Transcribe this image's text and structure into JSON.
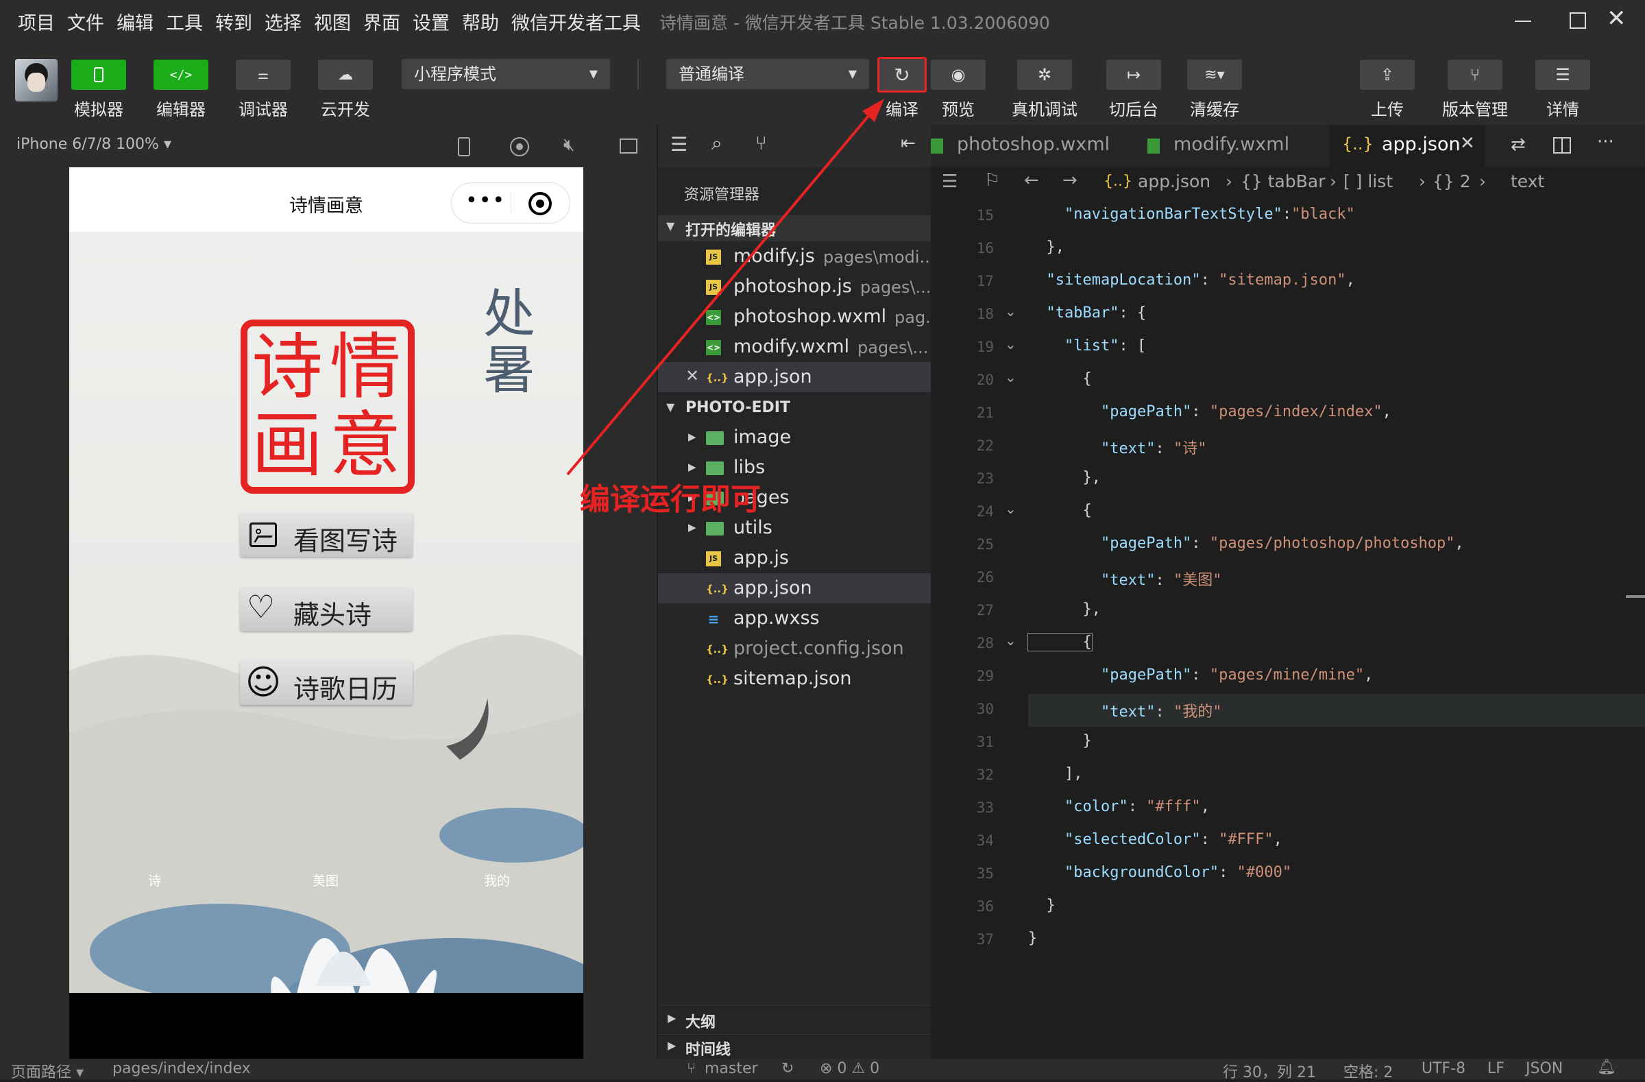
{
  "menu": [
    "项目",
    "文件",
    "编辑",
    "工具",
    "转到",
    "选择",
    "视图",
    "界面",
    "设置",
    "帮助",
    "微信开发者工具"
  ],
  "window_title": "诗情画意 - 微信开发者工具 Stable 1.03.2006090",
  "toolbar": {
    "simulator": "模拟器",
    "editor": "编辑器",
    "debugger": "调试器",
    "cloud": "云开发",
    "mode_select": "小程序模式",
    "compile_select": "普通编译",
    "compile": "编译",
    "preview": "预览",
    "real_debug": "真机调试",
    "background": "切后台",
    "clear_cache": "清缓存",
    "upload": "上传",
    "version": "版本管理",
    "details": "详情"
  },
  "simulator": {
    "device": "iPhone 6/7/8 100% ▾",
    "nav_title": "诗情画意",
    "seal_chars": [
      "诗",
      "情",
      "画",
      "意"
    ],
    "calligraphy": [
      "处",
      "暑"
    ],
    "buttons": [
      "看图写诗",
      "藏头诗",
      "诗歌日历"
    ],
    "tabs": [
      "诗",
      "美图",
      "我的"
    ]
  },
  "annotation": "编译运行即可",
  "explorer": {
    "title": "资源管理器",
    "open_editors_header": "打开的编辑器",
    "open_editors": [
      {
        "name": "modify.js",
        "path": "pages\\modi...",
        "icon": "js"
      },
      {
        "name": "photoshop.js",
        "path": "pages\\...",
        "icon": "js"
      },
      {
        "name": "photoshop.wxml",
        "path": "pag...",
        "icon": "wxml"
      },
      {
        "name": "modify.wxml",
        "path": "pages\\...",
        "icon": "wxml"
      },
      {
        "name": "app.json",
        "path": "",
        "icon": "json"
      }
    ],
    "project_header": "PHOTO-EDIT",
    "folders": [
      "image",
      "libs",
      "pages",
      "utils"
    ],
    "files": [
      {
        "name": "app.js",
        "icon": "js"
      },
      {
        "name": "app.json",
        "icon": "json"
      },
      {
        "name": "app.wxss",
        "icon": "wxss"
      },
      {
        "name": "project.config.json",
        "icon": "json"
      },
      {
        "name": "sitemap.json",
        "icon": "json"
      }
    ],
    "outline": "大纲",
    "timeline": "时间线"
  },
  "tabs": [
    "photoshop.wxml",
    "modify.wxml",
    "app.json"
  ],
  "breadcrumb": {
    "file": "app.json",
    "parts": [
      "{} tabBar",
      "[ ] list",
      "{} 2",
      "text"
    ]
  },
  "code_lines": [
    {
      "n": "15",
      "t": [
        [
          "    ",
          "p"
        ],
        [
          "\"navigationBarTextStyle\"",
          "k"
        ],
        [
          ":",
          "p"
        ],
        [
          "\"black\"",
          "s"
        ]
      ]
    },
    {
      "n": "16",
      "t": [
        [
          "  },",
          "p"
        ]
      ]
    },
    {
      "n": "17",
      "t": [
        [
          "  ",
          "p"
        ],
        [
          "\"sitemapLocation\"",
          "k"
        ],
        [
          ": ",
          "p"
        ],
        [
          "\"sitemap.json\"",
          "s"
        ],
        [
          ",",
          "p"
        ]
      ]
    },
    {
      "n": "18",
      "t": [
        [
          "  ",
          "p"
        ],
        [
          "\"tabBar\"",
          "k"
        ],
        [
          ": {",
          "p"
        ]
      ]
    },
    {
      "n": "19",
      "t": [
        [
          "    ",
          "p"
        ],
        [
          "\"list\"",
          "k"
        ],
        [
          ": [",
          "p"
        ]
      ]
    },
    {
      "n": "20",
      "t": [
        [
          "      {",
          "p"
        ]
      ]
    },
    {
      "n": "21",
      "t": [
        [
          "        ",
          "p"
        ],
        [
          "\"pagePath\"",
          "k"
        ],
        [
          ": ",
          "p"
        ],
        [
          "\"pages/index/index\"",
          "s"
        ],
        [
          ",",
          "p"
        ]
      ]
    },
    {
      "n": "22",
      "t": [
        [
          "        ",
          "p"
        ],
        [
          "\"text\"",
          "k"
        ],
        [
          ": ",
          "p"
        ],
        [
          "\"诗\"",
          "s"
        ]
      ]
    },
    {
      "n": "23",
      "t": [
        [
          "      },",
          "p"
        ]
      ]
    },
    {
      "n": "24",
      "t": [
        [
          "      {",
          "p"
        ]
      ]
    },
    {
      "n": "25",
      "t": [
        [
          "        ",
          "p"
        ],
        [
          "\"pagePath\"",
          "k"
        ],
        [
          ": ",
          "p"
        ],
        [
          "\"pages/photoshop/photoshop\"",
          "s"
        ],
        [
          ",",
          "p"
        ]
      ]
    },
    {
      "n": "26",
      "t": [
        [
          "        ",
          "p"
        ],
        [
          "\"text\"",
          "k"
        ],
        [
          ": ",
          "p"
        ],
        [
          "\"美图\"",
          "s"
        ]
      ]
    },
    {
      "n": "27",
      "t": [
        [
          "      },",
          "p"
        ]
      ]
    },
    {
      "n": "28",
      "t": [
        [
          "      {",
          "p"
        ]
      ]
    },
    {
      "n": "29",
      "t": [
        [
          "        ",
          "p"
        ],
        [
          "\"pagePath\"",
          "k"
        ],
        [
          ": ",
          "p"
        ],
        [
          "\"pages/mine/mine\"",
          "s"
        ],
        [
          ",",
          "p"
        ]
      ]
    },
    {
      "n": "30",
      "t": [
        [
          "        ",
          "p"
        ],
        [
          "\"text\"",
          "k"
        ],
        [
          ": ",
          "p"
        ],
        [
          "\"我的\"",
          "s"
        ]
      ]
    },
    {
      "n": "31",
      "t": [
        [
          "      }",
          "p"
        ]
      ]
    },
    {
      "n": "32",
      "t": [
        [
          "    ],",
          "p"
        ]
      ]
    },
    {
      "n": "33",
      "t": [
        [
          "    ",
          "p"
        ],
        [
          "\"color\"",
          "k"
        ],
        [
          ": ",
          "p"
        ],
        [
          "\"#fff\"",
          "s"
        ],
        [
          ",",
          "p"
        ]
      ]
    },
    {
      "n": "34",
      "t": [
        [
          "    ",
          "p"
        ],
        [
          "\"selectedColor\"",
          "k"
        ],
        [
          ": ",
          "p"
        ],
        [
          "\"#FFF\"",
          "s"
        ],
        [
          ",",
          "p"
        ]
      ]
    },
    {
      "n": "35",
      "t": [
        [
          "    ",
          "p"
        ],
        [
          "\"backgroundColor\"",
          "k"
        ],
        [
          ": ",
          "p"
        ],
        [
          "\"#000\"",
          "s"
        ]
      ]
    },
    {
      "n": "36",
      "t": [
        [
          "  }",
          "p"
        ]
      ]
    },
    {
      "n": "37",
      "t": [
        [
          "}",
          "p"
        ]
      ]
    }
  ],
  "status": {
    "page_path_label": "页面路径 ▾",
    "page_path": "pages/index/index",
    "branch": "master",
    "problems": "⊗ 0 ⚠ 0",
    "cursor": "行 30，列 21",
    "spaces": "空格: 2",
    "encoding": "UTF-8",
    "eol": "LF",
    "language": "JSON"
  },
  "colors": {
    "accent_green": "#1aad19",
    "highlight_red": "#e52322"
  }
}
